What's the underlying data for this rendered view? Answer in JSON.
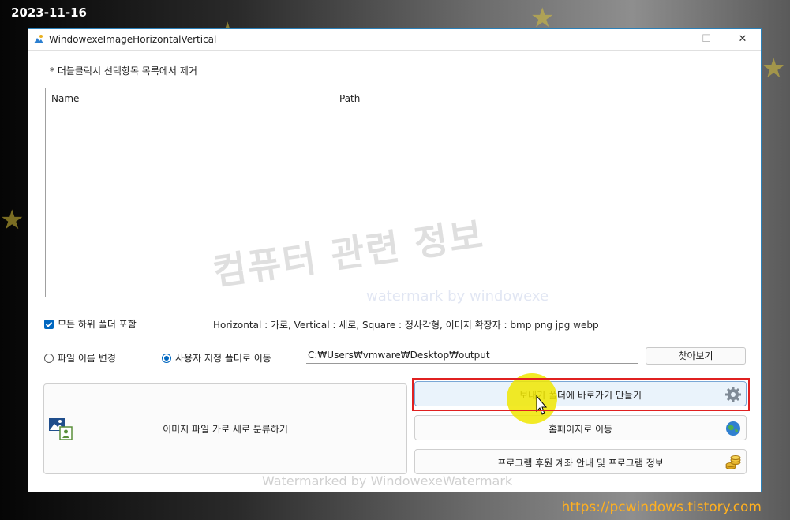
{
  "desktop": {
    "date": "2023-11-16",
    "site_url": "https://pcwindows.tistory.com"
  },
  "window": {
    "title": "WindowexeImageHorizontalVertical",
    "controls": {
      "minimize": "—",
      "maximize": "☐",
      "close": "✕"
    }
  },
  "main": {
    "hint": "* 더블클릭시 선택항목 목록에서 제거",
    "list": {
      "columns": [
        "Name",
        "Path"
      ],
      "rows": []
    },
    "include_subfolders": {
      "label": "모든 하위 폴더 포함",
      "checked": true
    },
    "info": "Horizontal : 가로, Vertical : 세로, Square : 정사각형, 이미지 확장자 : bmp png jpg webp",
    "radio_rename": {
      "label": "파일 이름 변경",
      "selected": false
    },
    "radio_move": {
      "label": "사용자 지정 폴더로 이동",
      "selected": true
    },
    "output_path": "C:₩Users₩vmware₩Desktop₩output",
    "browse_label": "찾아보기",
    "classify_label": "이미지 파일 가로 세로 분류하기",
    "shortcut_label": "보내기 폴더에 바로가기 만들기",
    "homepage_label": "홈페이지로 이동",
    "donate_label": "프로그램 후원 계좌 안내 및 프로그램 정보"
  },
  "watermarks": {
    "main": "컴퓨터 관련 정보",
    "sub": "watermark by windowexe",
    "bottom": "Watermarked by WindowexeWatermark"
  },
  "colors": {
    "accent": "#0067c0",
    "highlight": "#e02020",
    "url": "#ffb020"
  }
}
